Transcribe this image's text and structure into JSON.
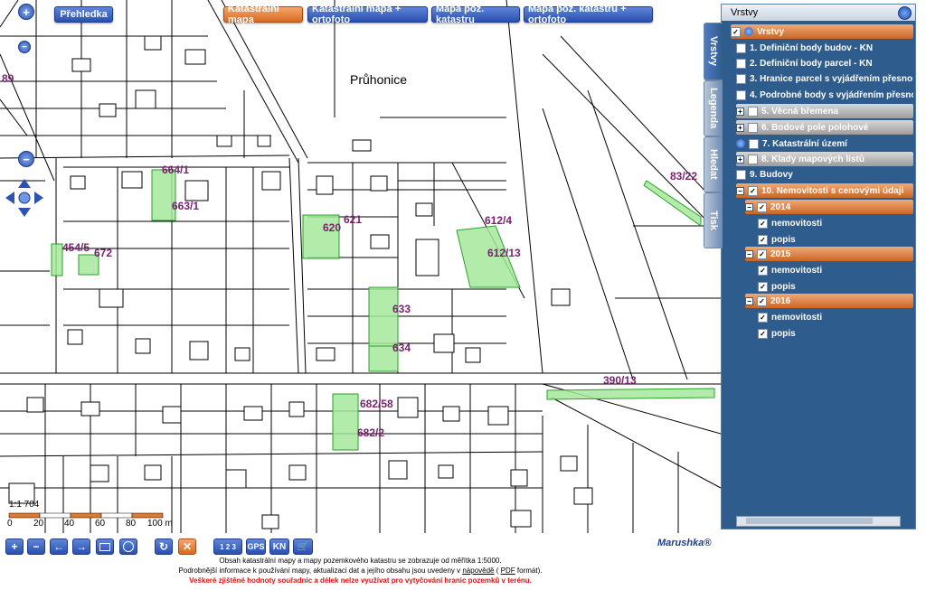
{
  "map": {
    "place_name": "Průhonice",
    "overview_button": "Přehledka",
    "map_modes": [
      {
        "label": "Katastrální mapa",
        "active": true
      },
      {
        "label": "Katastrální mapa + ortofoto",
        "active": false
      },
      {
        "label": "Mapa poz. katastru",
        "active": false
      },
      {
        "label": "Mapa poz. katastru + ortofoto",
        "active": false
      }
    ],
    "parcel_labels": [
      "664/1",
      "663/1",
      "454/5",
      "672",
      "621",
      "620",
      "612/4",
      "612/13",
      "83/22",
      "633",
      "634",
      "390/13",
      "682/58",
      "682/2",
      "89"
    ],
    "scale_ratio": "1:1 704",
    "scale_ticks": [
      "0",
      "20",
      "40",
      "60",
      "80",
      "100 m"
    ]
  },
  "panel": {
    "title": "Vrstvy",
    "tabs": [
      "Vrstvy",
      "Legenda",
      "Hledat",
      "Tisk"
    ],
    "layers": [
      {
        "label": "Vrstvy",
        "style": "orange",
        "checked": true
      },
      {
        "label": "1. Definiční body budov - KN",
        "style": "plain",
        "checked": false
      },
      {
        "label": "2. Definiční body parcel - KN",
        "style": "plain",
        "checked": false
      },
      {
        "label": "3. Hranice parcel s vyjádřením přesnosti -",
        "style": "plain",
        "checked": false
      },
      {
        "label": "4. Podrobné body s vyjádřením přesnosti -",
        "style": "plain",
        "checked": false
      },
      {
        "label": "5. Věcná břemena",
        "style": "grey",
        "checked": false
      },
      {
        "label": "6. Bodové pole polohové",
        "style": "grey",
        "checked": false
      },
      {
        "label": "7. Katastrální území",
        "style": "plain",
        "checked": false
      },
      {
        "label": "8. Klady mapových listů",
        "style": "grey",
        "checked": false
      },
      {
        "label": "9. Budovy",
        "style": "plain",
        "checked": false
      },
      {
        "label": "10. Nemovitosti s cenovými údaji",
        "style": "orange",
        "checked": true
      },
      {
        "label": "2014",
        "style": "orange",
        "checked": true
      },
      {
        "label": "nemovitosti",
        "style": "plain",
        "checked": true
      },
      {
        "label": "popis",
        "style": "plain",
        "checked": true
      },
      {
        "label": "2015",
        "style": "orange",
        "checked": true
      },
      {
        "label": "nemovitosti",
        "style": "plain",
        "checked": true
      },
      {
        "label": "popis",
        "style": "plain",
        "checked": true
      },
      {
        "label": "2016",
        "style": "orange",
        "checked": true
      },
      {
        "label": "nemovitosti",
        "style": "plain",
        "checked": true
      },
      {
        "label": "popis",
        "style": "plain",
        "checked": true
      }
    ]
  },
  "toolbar": {
    "zoom_in": "+",
    "zoom_out": "−",
    "back": "←",
    "forward": "→",
    "zoom_extent_icon": "rectangle-icon",
    "info_icon": "globe-icon",
    "refresh_icon": "refresh-icon",
    "clear": "✕",
    "measure_label": "1 2 3",
    "gps_label": "GPS",
    "kn_label": "KN",
    "cart_icon": "cart-icon"
  },
  "footer": {
    "line1": "Obsah katastrální mapy a mapy pozemkového katastru se zobrazuje od měřítka 1:5000.",
    "line2_prefix": "Podrobnější informace k používání mapy, aktualizaci dat a jejího obsahu jsou uvedeny v",
    "help_link": "nápovědě",
    "line2_mid": "(",
    "pdf_link": "PDF",
    "line2_suffix": "formát).",
    "warning": "Veškeré zjištěné hodnoty souřadnic a délek nelze využívat pro vytyčování hranic pozemků v terénu.",
    "brand": "Marushka®"
  }
}
